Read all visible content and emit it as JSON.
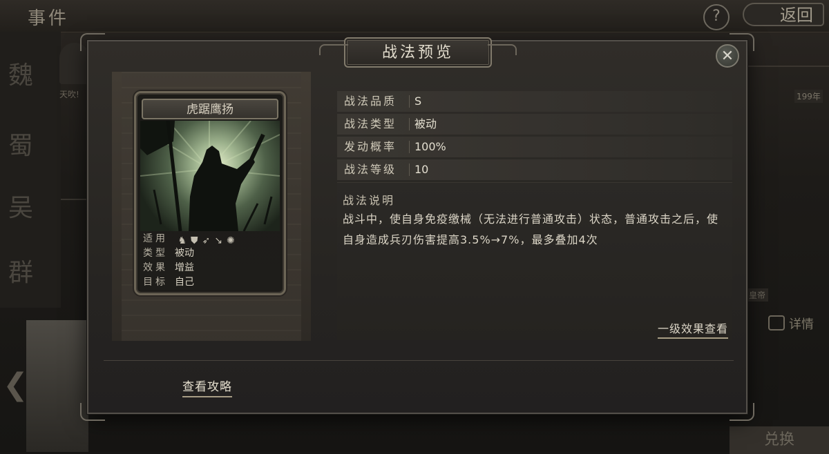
{
  "background": {
    "event_title": "事件",
    "help_label": "?",
    "back_label": "返回",
    "factions": [
      "魏",
      "蜀",
      "吴",
      "群"
    ],
    "portrait_caption": "天吹!",
    "year_badge": "199年",
    "emperor_tag": "皇帝",
    "details_label": "详情",
    "bottom_button": "兑换"
  },
  "modal": {
    "title": "战法预览",
    "close_label": "✕",
    "card": {
      "name": "虎踞鹰扬",
      "rows": [
        {
          "key": "适用",
          "value": ""
        },
        {
          "key": "类型",
          "value": "被动"
        },
        {
          "key": "效果",
          "value": "增益"
        },
        {
          "key": "目标",
          "value": "自己"
        }
      ],
      "type_icons": [
        "cavalry-icon",
        "shield-icon",
        "bow-icon",
        "spear-icon",
        "wheel-icon"
      ]
    },
    "attributes": [
      {
        "key": "战法品质",
        "value": "S"
      },
      {
        "key": "战法类型",
        "value": "被动"
      },
      {
        "key": "发动概率",
        "value": "100%"
      },
      {
        "key": "战法等级",
        "value": "10"
      }
    ],
    "description_title": "战法说明",
    "description_text": "战斗中，使自身免疫缴械（无法进行普通攻击）状态，普通攻击之后，使自身造成兵刃伤害提高3.5%→7%，最多叠加4次",
    "level_effect_link": "一级效果查看",
    "guide_link": "查看攻略"
  },
  "colors": {
    "accent_gold": "#a89e85",
    "panel": "#2b2926",
    "text": "#dcd6c7"
  }
}
